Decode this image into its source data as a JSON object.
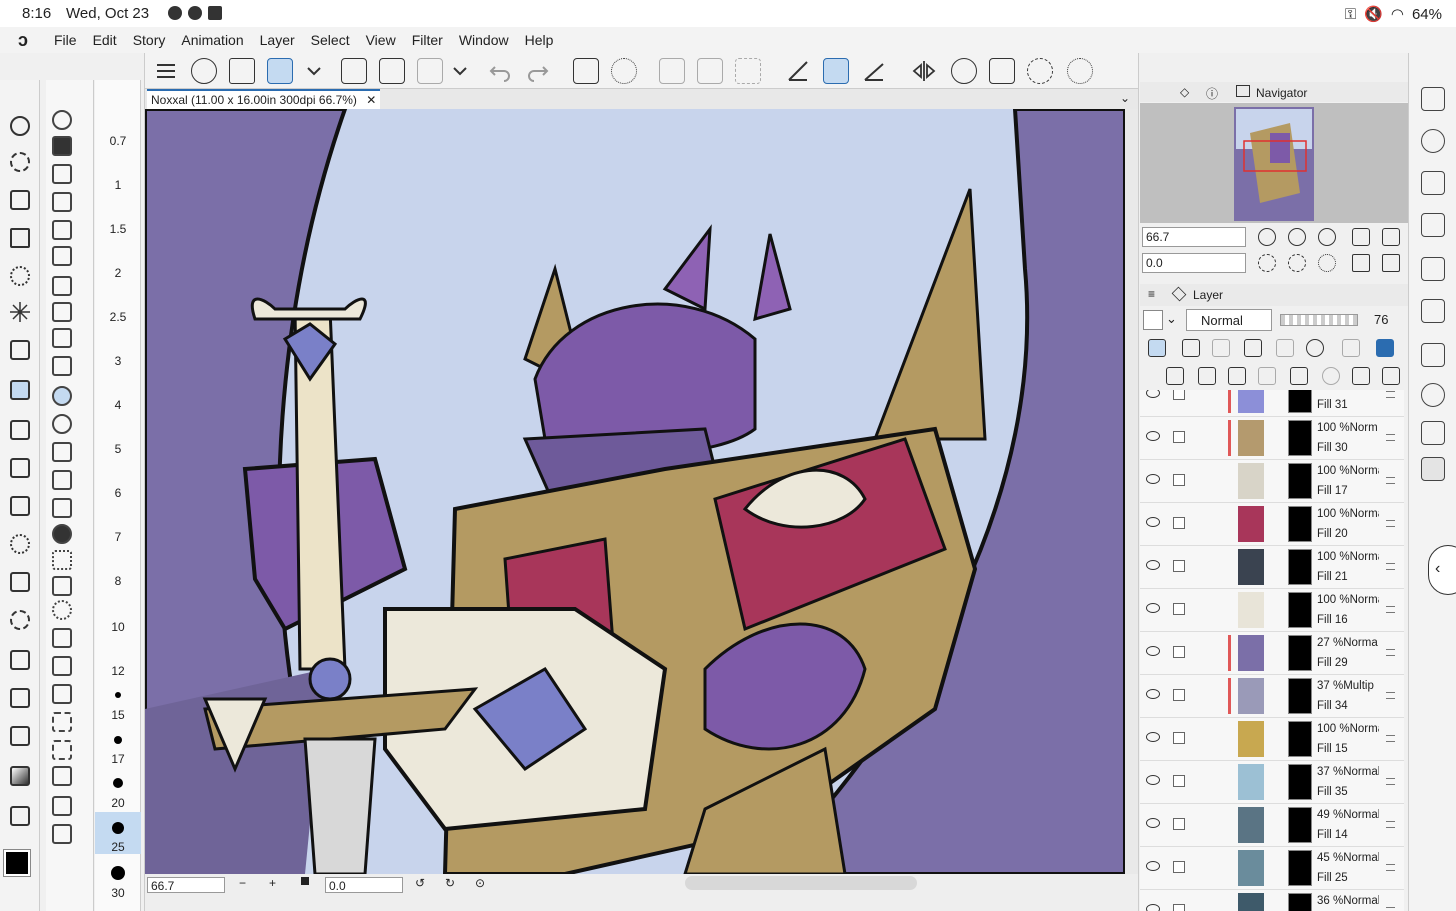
{
  "status": {
    "time": "8:16",
    "date": "Wed, Oct 23",
    "battery": "64%"
  },
  "menu": [
    "File",
    "Edit",
    "Story",
    "Animation",
    "Layer",
    "Select",
    "View",
    "Filter",
    "Window",
    "Help"
  ],
  "document_tab": "Noxxal (11.00 x 16.00in 300dpi 66.7%)",
  "brush_sizes": [
    "0.7",
    "1",
    "1.5",
    "2",
    "2.5",
    "3",
    "4",
    "5",
    "6",
    "7",
    "8",
    "10",
    "12",
    "15",
    "17",
    "20",
    "25",
    "30"
  ],
  "selected_size": "25",
  "canvas_bar": {
    "zoom": "66.7",
    "rotation": "0.0"
  },
  "navigator": {
    "title": "Navigator",
    "zoom": "66.7",
    "rotation": "0.0"
  },
  "layer_panel": {
    "title": "Layer",
    "blend_mode": "Normal",
    "opacity": "76"
  },
  "layers": [
    {
      "pct": "",
      "name": "Fill 31",
      "color": "#8c8fd8",
      "mark": true
    },
    {
      "pct": "100 %Norm",
      "name": "Fill 30",
      "color": "#b49a6e",
      "mark": true
    },
    {
      "pct": "100 %Norma",
      "name": "Fill 17",
      "color": "#d8d4c8",
      "mark": false
    },
    {
      "pct": "100 %Norma",
      "name": "Fill 20",
      "color": "#a8365a",
      "mark": false
    },
    {
      "pct": "100 %Norma",
      "name": "Fill 21",
      "color": "#3a4350",
      "mark": false
    },
    {
      "pct": "100 %Norma",
      "name": "Fill 16",
      "color": "#e8e4d8",
      "mark": false
    },
    {
      "pct": "27 %Norma",
      "name": "Fill 29",
      "color": "#7b6fa8",
      "mark": true
    },
    {
      "pct": "37 %Multip",
      "name": "Fill 34",
      "color": "#9a9ab8",
      "mark": true
    },
    {
      "pct": "100 %Norma",
      "name": "Fill 15",
      "color": "#c8a850",
      "mark": false
    },
    {
      "pct": "37 %Normal",
      "name": "Fill 35",
      "color": "#9cc0d4",
      "mark": false
    },
    {
      "pct": "49 %Normal",
      "name": "Fill 14",
      "color": "#5a7484",
      "mark": false
    },
    {
      "pct": "45 %Normal",
      "name": "Fill 25",
      "color": "#6a8c9c",
      "mark": false
    },
    {
      "pct": "36 %Normal",
      "name": "",
      "color": "#3e5a6a",
      "mark": false
    }
  ],
  "colors": {
    "accent": "#2b6cb0",
    "selected_bg": "#c4daf1",
    "sky": "#c8d4ec",
    "wing": "#7b6fa8",
    "gold": "#b49a62",
    "crimson": "#a8365a",
    "purple": "#7d5aa8"
  }
}
